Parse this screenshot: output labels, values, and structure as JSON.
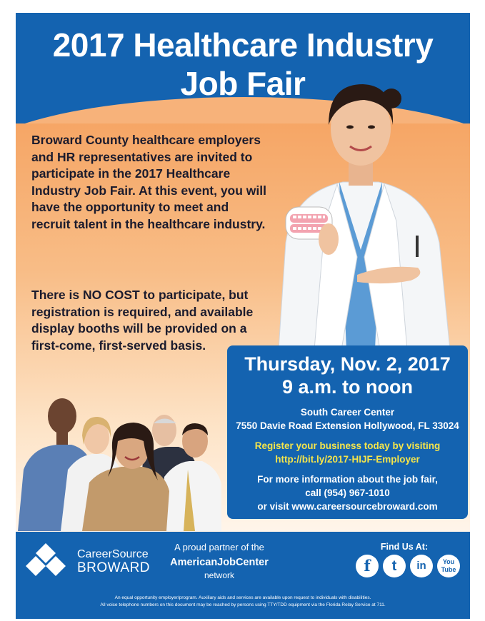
{
  "header": {
    "title_line1": "2017 Healthcare Industry",
    "title_line2": "Job Fair"
  },
  "intro": {
    "paragraph1": "Broward County healthcare employers and HR representatives are invited to participate in the 2017 Healthcare Industry Job Fair. At this event, you will have the opportunity to meet and recruit talent in the healthcare industry.",
    "paragraph2": "There is NO COST to participate, but registration is required, and available display booths will be provided on a first-come, first-served basis."
  },
  "event": {
    "date": "Thursday, Nov. 2, 2017",
    "time": "9 a.m. to noon",
    "venue": "South Career Center",
    "address": "7550 Davie Road Extension Hollywood, FL 33024",
    "register_line": "Register your business today by visiting",
    "register_url": "http://bit.ly/2017-HIJF-Employer",
    "info_line1": "For more information about the job fair,",
    "info_line2": "call (954) 967-1010",
    "info_line3": "or visit www.careersourcebroward.com"
  },
  "footer": {
    "brand_line1": "CareerSource",
    "brand_line2": "BROWARD",
    "partner_line": "A proud partner of the",
    "partner_name": "AmericanJobCenter",
    "partner_suffix": "network",
    "find_us": "Find Us At:",
    "social": {
      "facebook": "f",
      "twitter": "t",
      "linkedin": "in",
      "youtube_top": "You",
      "youtube_bottom": "Tube"
    },
    "fine_print1": "An equal opportunity employer/program. Auxiliary aids and services are available upon request to individuals with disabilities.",
    "fine_print2": "All voice telephone numbers on this document may be reached by persons using TTY/TDD equipment via the Florida Relay Service at 711."
  },
  "colors": {
    "brand_blue": "#1463b0",
    "orange": "#f5a260",
    "highlight_yellow": "#f6e54a"
  }
}
